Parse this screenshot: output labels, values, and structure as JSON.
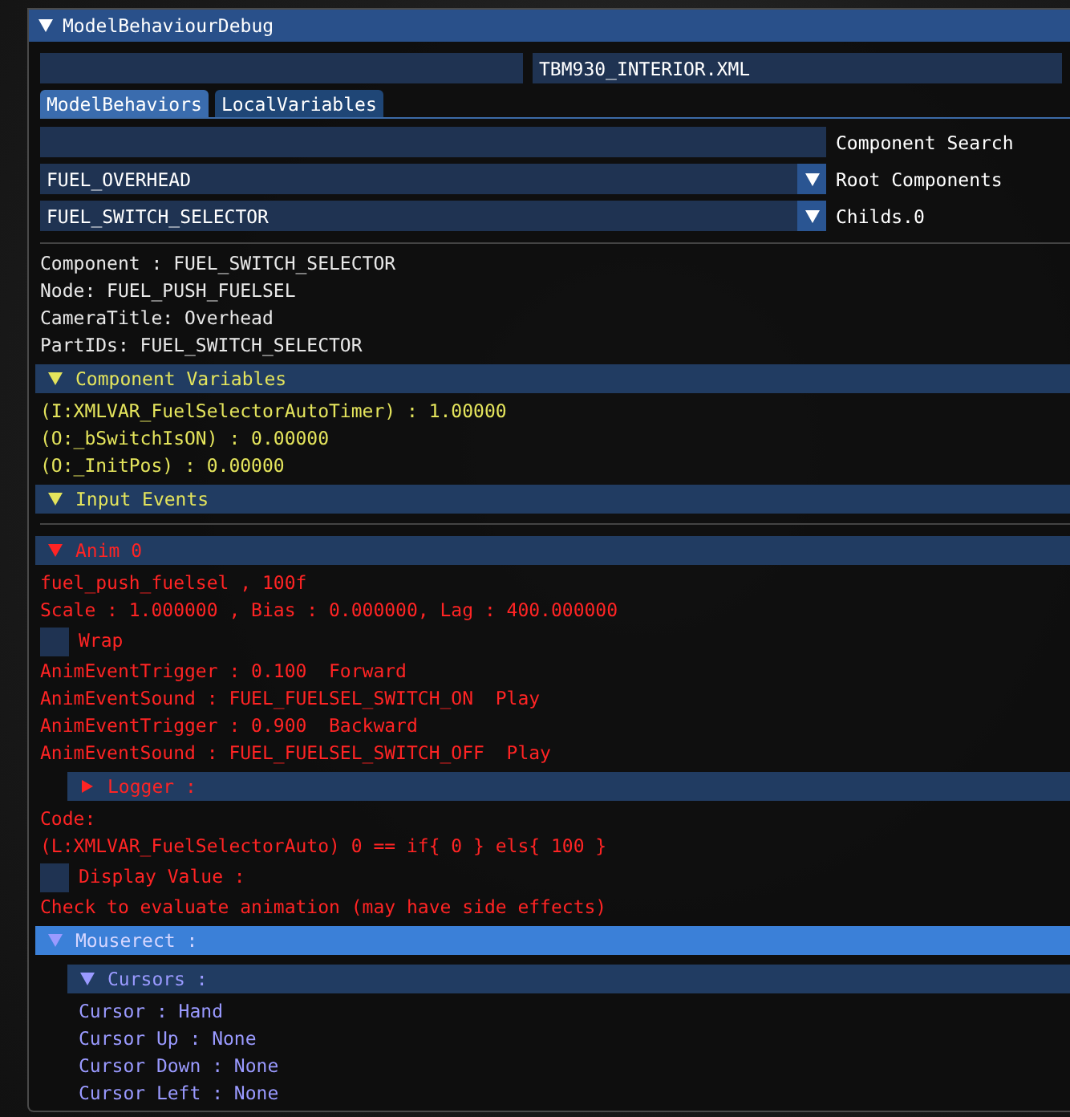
{
  "window": {
    "title": "ModelBehaviourDebug",
    "expanded": true
  },
  "file_field": {
    "value": "TBM930_INTERIOR.XML"
  },
  "tabs": [
    {
      "label": "ModelBehaviors",
      "selected": true
    },
    {
      "label": "LocalVariables",
      "selected": false
    }
  ],
  "search": {
    "label": "Component Search"
  },
  "combos": [
    {
      "value": "FUEL_OVERHEAD",
      "label": "Root Components"
    },
    {
      "value": "FUEL_SWITCH_SELECTOR",
      "label": "Childs.0"
    }
  ],
  "info": [
    "Component : FUEL_SWITCH_SELECTOR",
    "Node: FUEL_PUSH_FUELSEL",
    "CameraTitle: Overhead",
    "PartIDs: FUEL_SWITCH_SELECTOR"
  ],
  "sections": [
    {
      "title": "Component Variables",
      "expanded": true,
      "selected": false,
      "color": "#e4e45c",
      "items": [
        {
          "kind": "text",
          "text": "(I:XMLVAR_FuelSelectorAutoTimer) : 1.00000"
        },
        {
          "kind": "text",
          "text": "(O:_bSwitchIsON) : 0.00000"
        },
        {
          "kind": "text",
          "text": "(O:_InitPos) : 0.00000"
        }
      ]
    },
    {
      "title": "Input Events",
      "expanded": true,
      "selected": false,
      "color": "#e4e45c"
    },
    {
      "title": "Anim 0",
      "expanded": true,
      "selected": false,
      "color": "#ff2424",
      "items": [
        {
          "kind": "text",
          "text": "fuel_push_fuelsel , 100f"
        },
        {
          "kind": "text",
          "text": "Scale : 1.000000 , Bias : 0.000000, Lag : 400.000000"
        },
        {
          "kind": "checkbox",
          "text": "Wrap",
          "checked": false
        },
        {
          "kind": "text",
          "text": "AnimEventTrigger : 0.100  Forward"
        },
        {
          "kind": "text",
          "text": "AnimEventSound : FUEL_FUELSEL_SWITCH_ON  Play"
        },
        {
          "kind": "text",
          "text": "AnimEventTrigger : 0.900  Backward"
        },
        {
          "kind": "text",
          "text": "AnimEventSound : FUEL_FUELSEL_SWITCH_OFF  Play"
        },
        {
          "kind": "section",
          "title": "Logger :",
          "expanded": false,
          "selected": false,
          "color": "#ff2424"
        },
        {
          "kind": "text",
          "text": "Code:"
        },
        {
          "kind": "text",
          "text": "(L:XMLVAR_FuelSelectorAuto) 0 == if{ 0 } els{ 100 }"
        },
        {
          "kind": "checkbox",
          "text": "Display Value :",
          "checked": false
        },
        {
          "kind": "text",
          "text": "Check to evaluate animation (may have side effects)"
        }
      ]
    },
    {
      "title": "Mouserect :",
      "expanded": true,
      "selected": true,
      "color": "#9a9aff",
      "items": [
        {
          "kind": "section",
          "title": "Cursors :",
          "expanded": true,
          "selected": false,
          "color": "#9a9aff",
          "items": [
            {
              "kind": "text",
              "text": "Cursor : Hand"
            },
            {
              "kind": "text",
              "text": "Cursor Up : None"
            },
            {
              "kind": "text",
              "text": "Cursor Down : None"
            },
            {
              "kind": "text",
              "text": "Cursor Left : None"
            }
          ]
        }
      ]
    }
  ]
}
